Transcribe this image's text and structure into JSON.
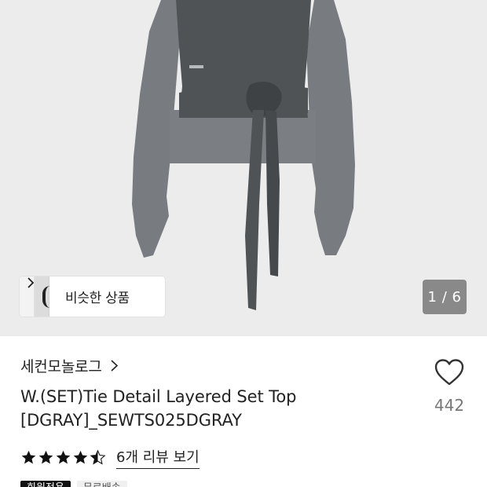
{
  "gallery": {
    "similar_label": "비슷한 상품",
    "page_counter": "1 / 6"
  },
  "product": {
    "brand": "세컨모놀로그",
    "title_line1": "W.(SET)Tie Detail Layered Set Top",
    "title_line2": "[DGRAY]_SEWTS025DGRAY",
    "likes": "442",
    "rating": 4.5,
    "review_link": "6개 리뷰 보기"
  },
  "badges": [
    {
      "label": "회원전용"
    },
    {
      "label": "무료배송"
    }
  ],
  "colors": {
    "gallery_bg": "#ececec",
    "garment_dark": "#505356",
    "garment_light": "#7b7e82",
    "star": "#111111"
  },
  "icons": {
    "similar_chevron": "chevron-right-icon",
    "brand_chevron": "chevron-right-icon",
    "like": "heart-outline-icon",
    "star_full": "star-filled-icon",
    "star_half": "star-half-icon"
  }
}
